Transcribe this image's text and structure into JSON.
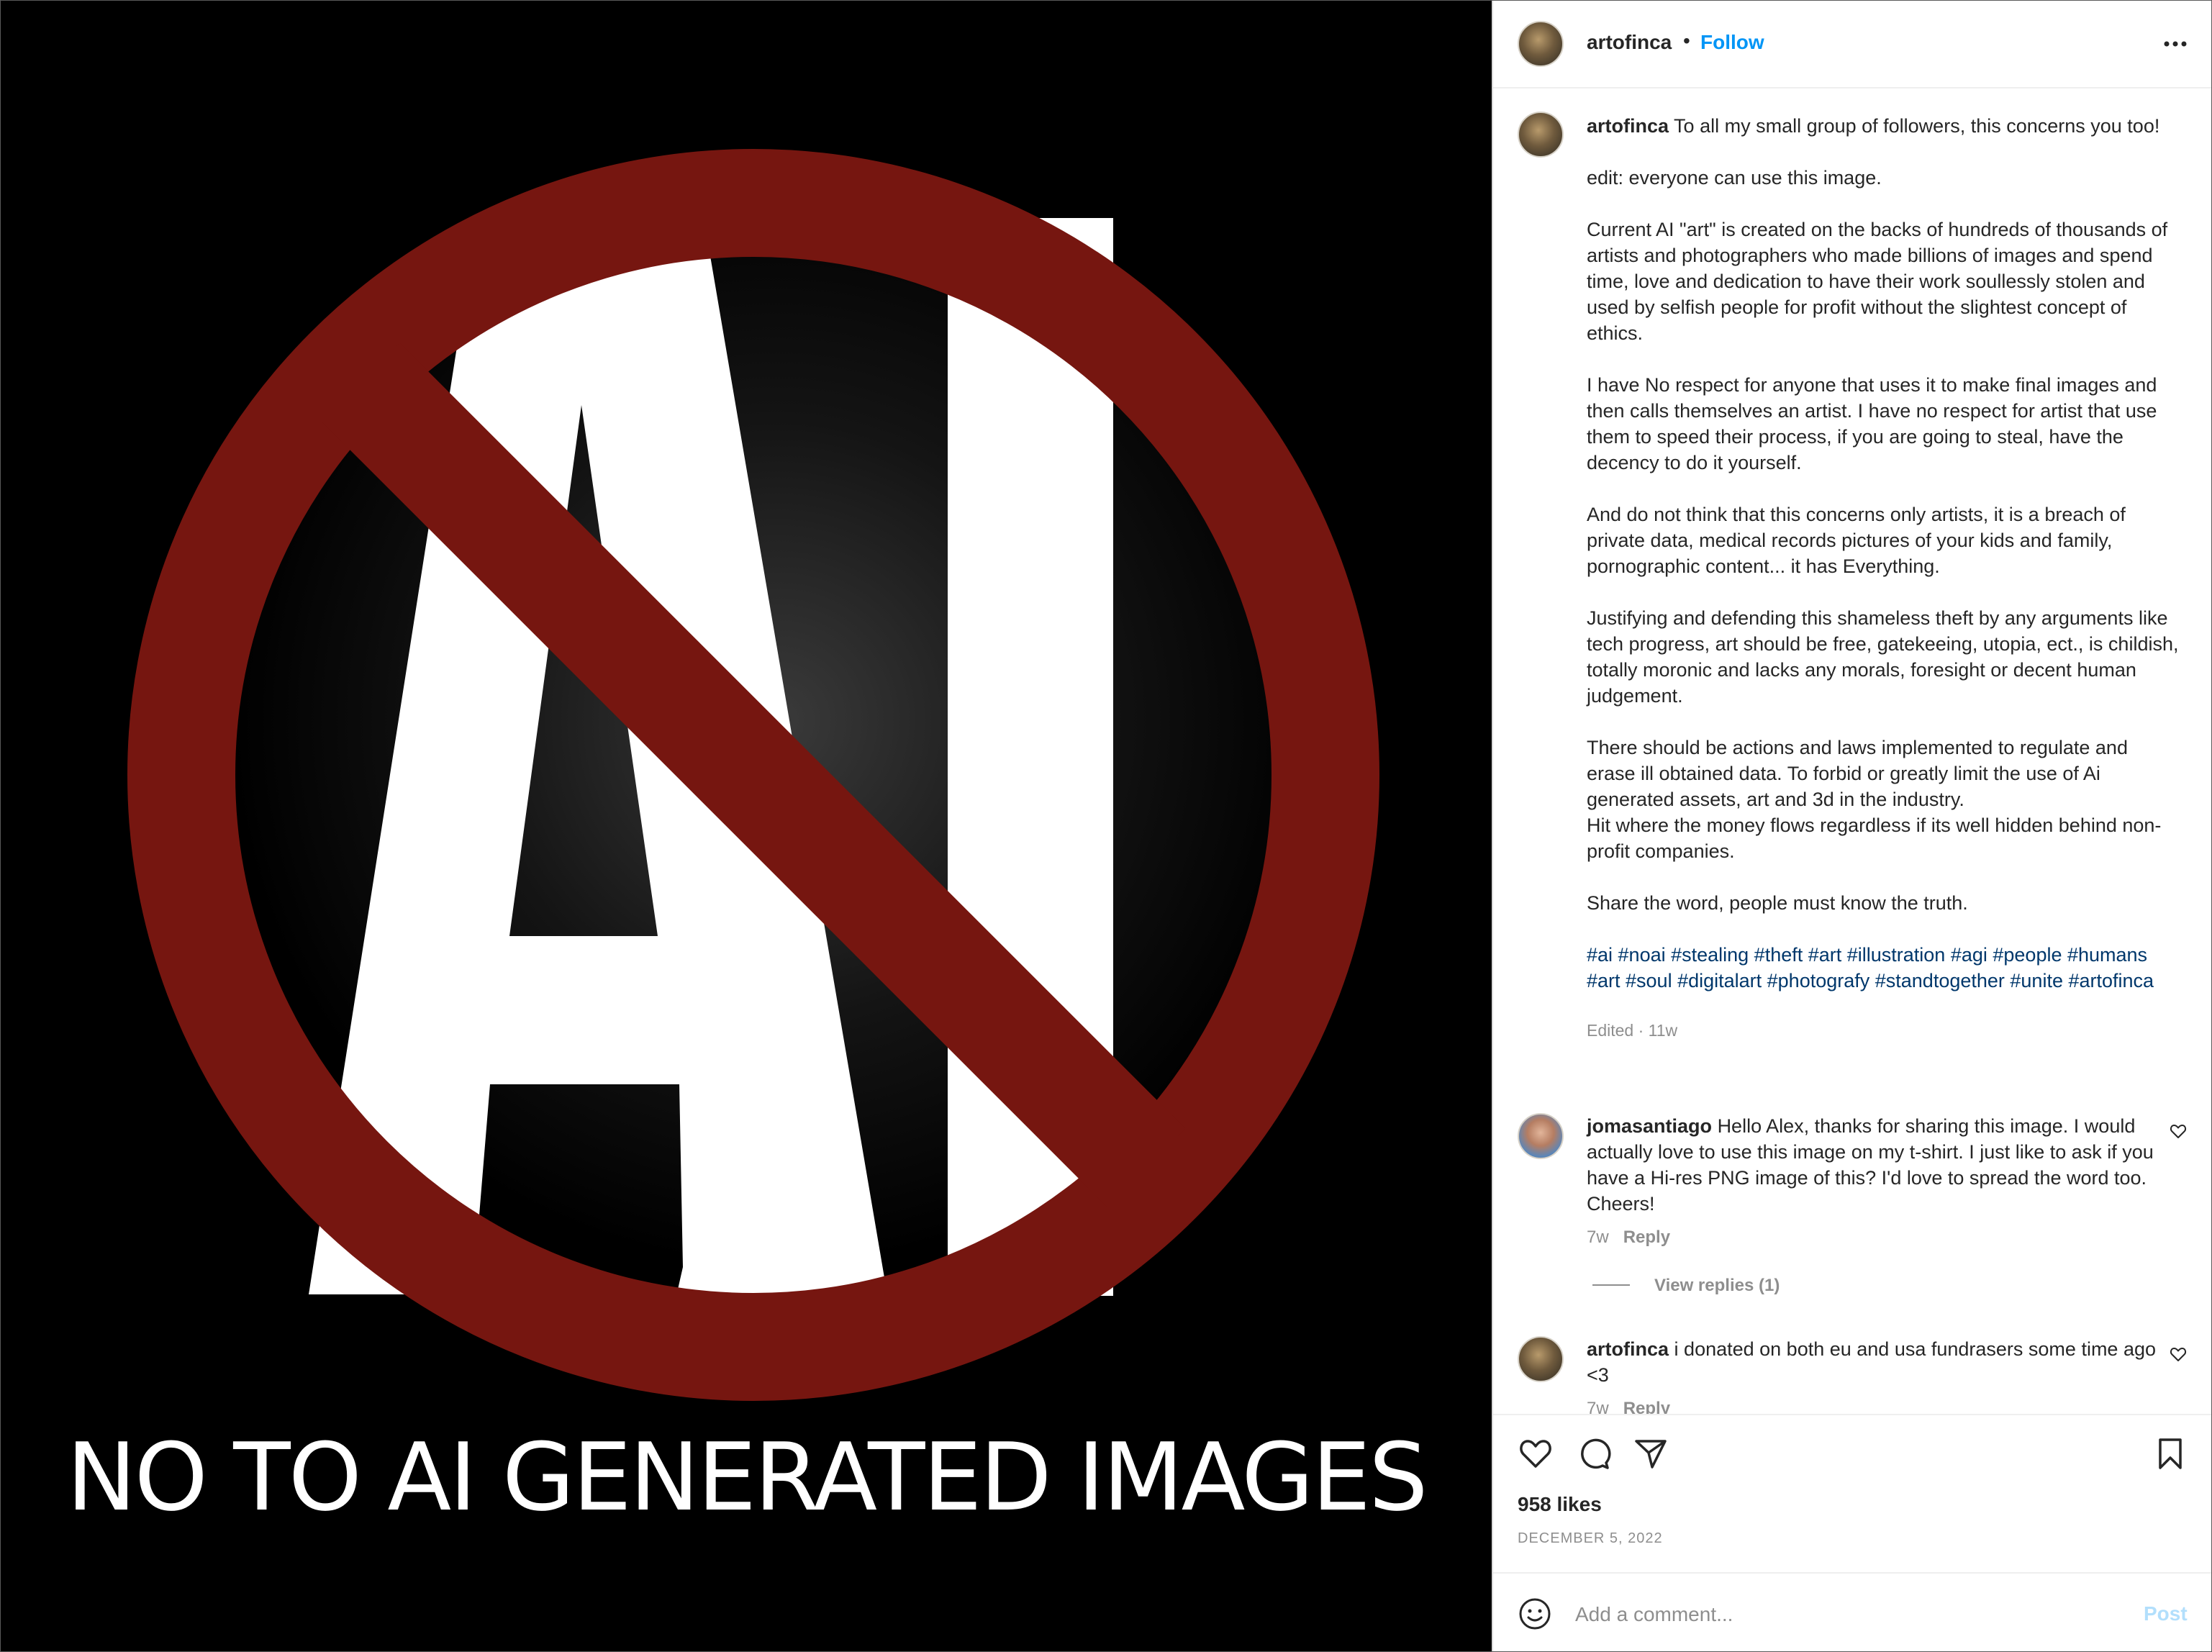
{
  "media": {
    "caption": "NO TO AI GENERATED IMAGES",
    "logo_letters": "AI",
    "colors": {
      "background": "#000000",
      "ring": "#761610",
      "letters": "#ffffff"
    }
  },
  "header": {
    "username": "artofinca",
    "separator": "•",
    "follow_label": "Follow",
    "more_icon": "more-horizontal-icon"
  },
  "caption": {
    "username": "artofinca",
    "paragraphs": [
      "To all my small group of followers, this concerns you too!",
      "edit: everyone can use this image.",
      "Current AI \"art\" is created on the backs of hundreds of thousands of artists and photographers who made billions of images and spend time, love and dedication to have their work soullessly stolen and used by selfish people for profit without the slightest concept of ethics.",
      "I have No respect for anyone that uses it to make final images and then calls themselves an artist. I have no respect for artist that use them to speed their process, if you are going to steal, have the decency to do it yourself.",
      "And do not think that this concerns only artists, it is a breach of private data, medical records pictures of your kids and family, pornographic content... it has Everything.",
      "Justifying and defending this shameless theft by any arguments like tech progress, art should be free, gatekeeing, utopia, ect., is childish, totally moronic and lacks any morals, foresight or decent human judgement.",
      "There should be actions and laws implemented to regulate and erase ill obtained data. To forbid or greatly limit the use of Ai generated assets, art and 3d in the industry.",
      "Hit where the money flows regardless if its well hidden behind non-profit companies.",
      "Share the word, people must know the truth."
    ],
    "hashtags": "#ai #noai #stealing #theft #art #illustration #agi #people #humans #art #soul #digitalart #photografy #standtogether #unite #artofinca",
    "meta": "Edited · 11w"
  },
  "comments": [
    {
      "username": "jomasantiago",
      "text": "Hello Alex, thanks for sharing this image. I would actually love to use this image on my t-shirt. I just like to ask if you have a Hi-res PNG image of this? I'd love to spread the word too. Cheers!",
      "time": "7w",
      "reply_label": "Reply",
      "view_replies": "View replies (1)"
    },
    {
      "username": "artofinca",
      "text": "i donated on both eu and usa fundrasers some time ago <3",
      "time": "7w",
      "reply_label": "Reply"
    }
  ],
  "actions": {
    "icons": [
      "heart-icon",
      "comment-icon",
      "share-icon",
      "bookmark-icon"
    ],
    "likes": "958 likes",
    "date": "DECEMBER 5, 2022"
  },
  "add_comment": {
    "placeholder": "Add a comment...",
    "post_label": "Post",
    "post_color": "#b2dffc"
  }
}
